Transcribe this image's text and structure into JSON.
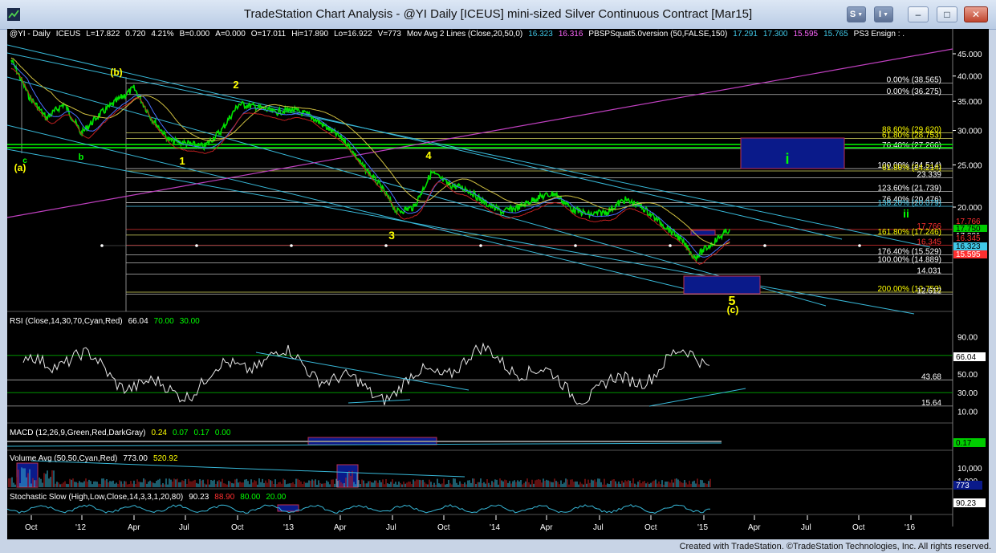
{
  "window": {
    "title": "TradeStation Chart Analysis - @YI Daily [ICEUS] mini-sized Silver Continuous Contract [Mar15]",
    "btn_s": "S",
    "btn_i": "I",
    "min_glyph": "–",
    "max_glyph": "□",
    "close_glyph": "✕"
  },
  "footer": "Created with TradeStation. ©TradeStation Technologies, Inc. All rights reserved.",
  "colors": {
    "bg": "#000000",
    "yellow": "#ffff00",
    "cyan": "#40c8e8",
    "white": "#ffffff",
    "green": "#00ff00",
    "red": "#ff3030",
    "magenta": "#c040c0",
    "blue": "#3040ff",
    "navy": "#0a1a8a"
  },
  "price_header": [
    {
      "t": "@YI - Daily",
      "c": "#ffffff"
    },
    {
      "t": "ICEUS",
      "c": "#ffffff"
    },
    {
      "t": "L=17.822",
      "c": "#ffffff"
    },
    {
      "t": "0.720",
      "c": "#ffffff"
    },
    {
      "t": "4.21%",
      "c": "#ffffff"
    },
    {
      "t": "B=0.000",
      "c": "#ffffff"
    },
    {
      "t": "A=0.000",
      "c": "#ffffff"
    },
    {
      "t": "O=17.011",
      "c": "#ffffff"
    },
    {
      "t": "Hi=17.890",
      "c": "#ffffff"
    },
    {
      "t": "Lo=16.922",
      "c": "#ffffff"
    },
    {
      "t": "V=773",
      "c": "#ffffff"
    },
    {
      "t": "Mov Avg 2 Lines (Close,20,50,0)",
      "c": "#ffffff"
    },
    {
      "t": "16.323",
      "c": "#40c8e8"
    },
    {
      "t": "16.316",
      "c": "#ff66ff"
    },
    {
      "t": "PBSPSquat5.0version (50,FALSE,150)",
      "c": "#ffffff"
    },
    {
      "t": "17.291",
      "c": "#40c8e8"
    },
    {
      "t": "17.300",
      "c": "#40c8e8"
    },
    {
      "t": "15.595",
      "c": "#ff66ff"
    },
    {
      "t": "15.765",
      "c": "#40c8e8"
    },
    {
      "t": "PS3 Ensign : .",
      "c": "#ffffff"
    }
  ],
  "price_axis": {
    "ticks": [
      "45.000",
      "40.000",
      "35.000",
      "30.000",
      "25.000",
      "20.000"
    ]
  },
  "price_tags": [
    {
      "t": "17.766",
      "bg": "#000000",
      "fg": "#ff3030"
    },
    {
      "t": "17.750",
      "bg": "#00cc00",
      "fg": "#000000"
    },
    {
      "t": "17.291",
      "bg": "#000000",
      "fg": "#ffffff"
    },
    {
      "t": "16.345",
      "bg": "#000000",
      "fg": "#ff3030"
    },
    {
      "t": "16.323",
      "bg": "#40c8e8",
      "fg": "#000000"
    },
    {
      "t": "15.595",
      "bg": "#ff3030",
      "fg": "#ffffff"
    }
  ],
  "fib_labels": [
    {
      "t": "0.00% (38.565)",
      "c": "#ffffff"
    },
    {
      "t": "0.00% (36.275)",
      "c": "#ffffff"
    },
    {
      "t": "88.60% (29.620)",
      "c": "#ffff00"
    },
    {
      "t": "61.80% (28.753)",
      "c": "#ffff00"
    },
    {
      "t": "76.40% (27.266)",
      "c": "#ffffff"
    },
    {
      "t": "100.00% (24.514)",
      "c": "#ffffff"
    },
    {
      "t": "61.80% (24.214)",
      "c": "#ffff00"
    },
    {
      "t": "23.339",
      "c": "#ffffff"
    },
    {
      "t": "123.60% (21.739)",
      "c": "#ffffff"
    },
    {
      "t": "76.40% (20.476)",
      "c": "#ffffff"
    },
    {
      "t": "138.20% (20.079)",
      "c": "#40c8e8"
    },
    {
      "t": "17.766",
      "c": "#ff3030"
    },
    {
      "t": "161.80% (17.246)",
      "c": "#ffff00"
    },
    {
      "t": "16.345",
      "c": "#ff3030"
    },
    {
      "t": "176.40% (15.529)",
      "c": "#ffffff"
    },
    {
      "t": "100.00% (14.889)",
      "c": "#ffffff"
    },
    {
      "t": "14.031",
      "c": "#ffffff"
    },
    {
      "t": "200.00% (12.753)",
      "c": "#ffff00"
    },
    {
      "t": "12.612",
      "c": "#ffffff"
    }
  ],
  "wave_labels": [
    {
      "t": "(b)",
      "c": "#ffff00"
    },
    {
      "t": "2",
      "c": "#ffff00"
    },
    {
      "t": "4",
      "c": "#ffff00"
    },
    {
      "t": "1",
      "c": "#ffff00"
    },
    {
      "t": "3",
      "c": "#ffff00"
    },
    {
      "t": "(a)",
      "c": "#ffff00"
    },
    {
      "t": "c",
      "c": "#00ff00"
    },
    {
      "t": "b",
      "c": "#00ff00"
    },
    {
      "t": "i",
      "c": "#00ff00"
    },
    {
      "t": "ii",
      "c": "#00ff00"
    },
    {
      "t": "5",
      "c": "#ffff00"
    },
    {
      "t": "(c)",
      "c": "#ffff00"
    }
  ],
  "rsi": {
    "header": [
      {
        "t": "RSI (Close,14,30,70,Cyan,Red)",
        "c": "#ffffff"
      },
      {
        "t": "66.04",
        "c": "#ffffff"
      },
      {
        "t": "70.00",
        "c": "#00ff00"
      },
      {
        "t": "30.00",
        "c": "#00ff00"
      }
    ],
    "ticks": [
      "90.00",
      "70.00",
      "50.00",
      "30.00",
      "10.00"
    ],
    "levels": [
      "43.68",
      "15.64"
    ],
    "tag": "66.04"
  },
  "macd": {
    "header": [
      {
        "t": "MACD (12,26,9,Green,Red,DarkGray)",
        "c": "#ffffff"
      },
      {
        "t": "0.24",
        "c": "#ffff00"
      },
      {
        "t": "0.07",
        "c": "#00ff00"
      },
      {
        "t": "0.17",
        "c": "#00ff00"
      },
      {
        "t": "0.00",
        "c": "#00ff00"
      }
    ],
    "tag": "0.17"
  },
  "volume": {
    "header": [
      {
        "t": "Volume Avg (50,50,Cyan,Red)",
        "c": "#ffffff"
      },
      {
        "t": "773.00",
        "c": "#ffffff"
      },
      {
        "t": "520.92",
        "c": "#ffff00"
      }
    ],
    "ticks": [
      "10,000",
      "1,000"
    ],
    "tag": "773"
  },
  "stoch": {
    "header": [
      {
        "t": "Stochastic Slow (High,Low,Close,14,3,3,1,20,80)",
        "c": "#ffffff"
      },
      {
        "t": "90.23",
        "c": "#ffffff"
      },
      {
        "t": "88.90",
        "c": "#ff3030"
      },
      {
        "t": "80.00",
        "c": "#00ff00"
      },
      {
        "t": "20.00",
        "c": "#00ff00"
      }
    ],
    "tag": "90.23"
  },
  "chart_data": {
    "type": "line",
    "title": "@YI Daily [ICEUS] mini-sized Silver Continuous Contract [Mar15]",
    "x_labels": [
      "Oct",
      "'12",
      "Apr",
      "Jul",
      "Oct",
      "'13",
      "Apr",
      "Jul",
      "Oct",
      "'14",
      "Apr",
      "Jul",
      "Oct",
      "'15",
      "Apr",
      "Jul",
      "Oct",
      "'16"
    ],
    "ylim": [
      11,
      47
    ],
    "series": [
      {
        "name": "Close",
        "x": [
          "2011-08",
          "2011-09",
          "2011-10",
          "2011-11",
          "2011-12",
          "2012-01",
          "2012-02",
          "2012-03",
          "2012-04",
          "2012-05",
          "2012-06",
          "2012-07",
          "2012-08",
          "2012-09",
          "2012-10",
          "2012-11",
          "2012-12",
          "2013-01",
          "2013-02",
          "2013-03",
          "2013-04",
          "2013-05",
          "2013-06",
          "2013-07",
          "2013-08",
          "2013-09",
          "2013-10",
          "2013-11",
          "2013-12",
          "2014-01",
          "2014-02",
          "2014-03",
          "2014-04",
          "2014-05",
          "2014-06",
          "2014-07",
          "2014-08",
          "2014-09",
          "2014-10",
          "2014-11",
          "2014-12",
          "2015-01"
        ],
        "values": [
          43.5,
          36.0,
          32.0,
          34.5,
          29.5,
          32.5,
          35.0,
          37.5,
          32.0,
          28.5,
          28.0,
          27.5,
          30.0,
          34.5,
          34.0,
          33.0,
          33.5,
          32.5,
          30.5,
          28.5,
          25.0,
          22.5,
          19.5,
          20.0,
          24.0,
          22.5,
          22.0,
          20.5,
          19.5,
          20.0,
          21.0,
          21.5,
          19.8,
          19.2,
          19.5,
          20.8,
          20.0,
          18.5,
          17.2,
          15.3,
          16.5,
          17.8
        ]
      }
    ],
    "levels": {
      "0.00% (38.565)": 38.565,
      "0.00% (36.275)": 36.275,
      "76.40% (27.266)": 27.266,
      "100.00% (24.514)": 24.514,
      "123.60% (21.739)": 21.739,
      "76.40% (20.476)": 20.476,
      "161.80% (17.246)": 17.246,
      "176.40% (15.529)": 15.529,
      "100.00% (14.889)": 14.889,
      "200.00% (12.753)": 12.753
    }
  }
}
